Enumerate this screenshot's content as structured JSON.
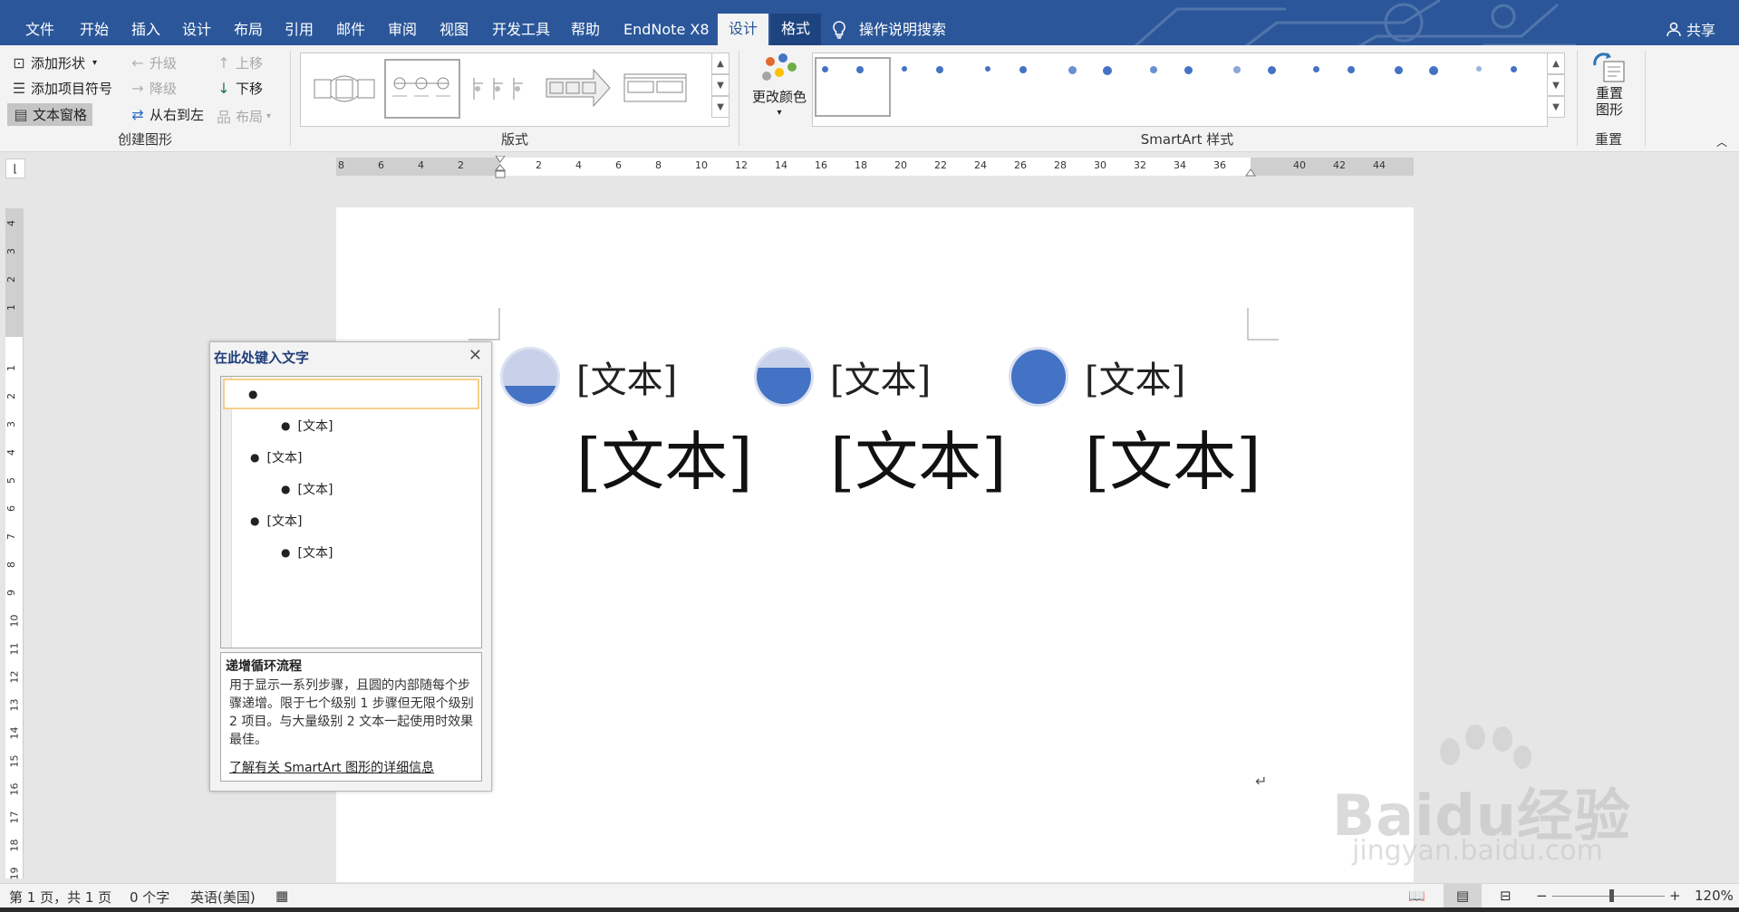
{
  "tabs": [
    {
      "label": "文件"
    },
    {
      "label": "开始"
    },
    {
      "label": "插入"
    },
    {
      "label": "设计"
    },
    {
      "label": "布局"
    },
    {
      "label": "引用"
    },
    {
      "label": "邮件"
    },
    {
      "label": "审阅"
    },
    {
      "label": "视图"
    },
    {
      "label": "开发工具"
    },
    {
      "label": "帮助"
    },
    {
      "label": "EndNote X8"
    },
    {
      "label": "设计"
    },
    {
      "label": "格式"
    }
  ],
  "search_label": "操作说明搜索",
  "share_label": "共享",
  "ribbon": {
    "create_graphic": {
      "add_shape": "添加形状",
      "add_bullet": "添加项目符号",
      "text_pane": "文本窗格",
      "promote": "升级",
      "demote": "降级",
      "right_to_left": "从右到左",
      "move_up": "上移",
      "move_down": "下移",
      "layout": "布局",
      "label": "创建图形"
    },
    "layouts_label": "版式",
    "change_colors": "更改颜色",
    "smartart_styles_label": "SmartArt 样式",
    "reset": {
      "button": "重置\n图形",
      "button_line1": "重置",
      "button_line2": "图形",
      "label": "重置"
    }
  },
  "ruler": {
    "h_left": [
      "8",
      "6",
      "4",
      "2"
    ],
    "h_right": [
      "2",
      "4",
      "6",
      "8",
      "10",
      "12",
      "14",
      "16",
      "18",
      "20",
      "22",
      "24",
      "26",
      "28",
      "30",
      "32",
      "34",
      "36",
      "40",
      "42",
      "44"
    ],
    "v_top": [
      "4",
      "3",
      "2",
      "1"
    ],
    "v_main": [
      "1",
      "2",
      "3",
      "4",
      "5",
      "6",
      "7",
      "8",
      "9",
      "10",
      "11",
      "12",
      "13",
      "14",
      "15",
      "16",
      "17",
      "18",
      "19"
    ]
  },
  "smartart": {
    "level1": [
      "[文本]",
      "[文本]",
      "[文本]"
    ],
    "level2": [
      "[文本]",
      "[文本]",
      "[文本]"
    ],
    "fill_levels": [
      0.33,
      0.66,
      1.0
    ],
    "accent_color": "#4472c4",
    "light_color": "#c8d1e9"
  },
  "text_pane": {
    "title": "在此处键入文字",
    "items": [
      {
        "level": 1,
        "text": ""
      },
      {
        "level": 2,
        "text": "[文本]"
      },
      {
        "level": 1,
        "text": "[文本]"
      },
      {
        "level": 2,
        "text": "[文本]"
      },
      {
        "level": 1,
        "text": "[文本]"
      },
      {
        "level": 2,
        "text": "[文本]"
      }
    ],
    "desc_title": "递增循环流程",
    "desc_text": "用于显示一系列步骤，且圆的内部随每个步骤递增。限于七个级别 1 步骤但无限个级别 2 项目。与大量级别 2 文本一起使用时效果最佳。",
    "link": "了解有关 SmartArt 图形的详细信息"
  },
  "status": {
    "page": "第 1 页，共 1 页",
    "words": "0 个字",
    "lang": "英语(美国)",
    "zoom": "120%"
  },
  "watermark": {
    "brand": "Baidu经验",
    "url": "jingyan.baidu.com"
  },
  "colors": {
    "title_bar": "#2b579a",
    "ribbon": "#f3f3f3",
    "accent": "#4472c4"
  }
}
